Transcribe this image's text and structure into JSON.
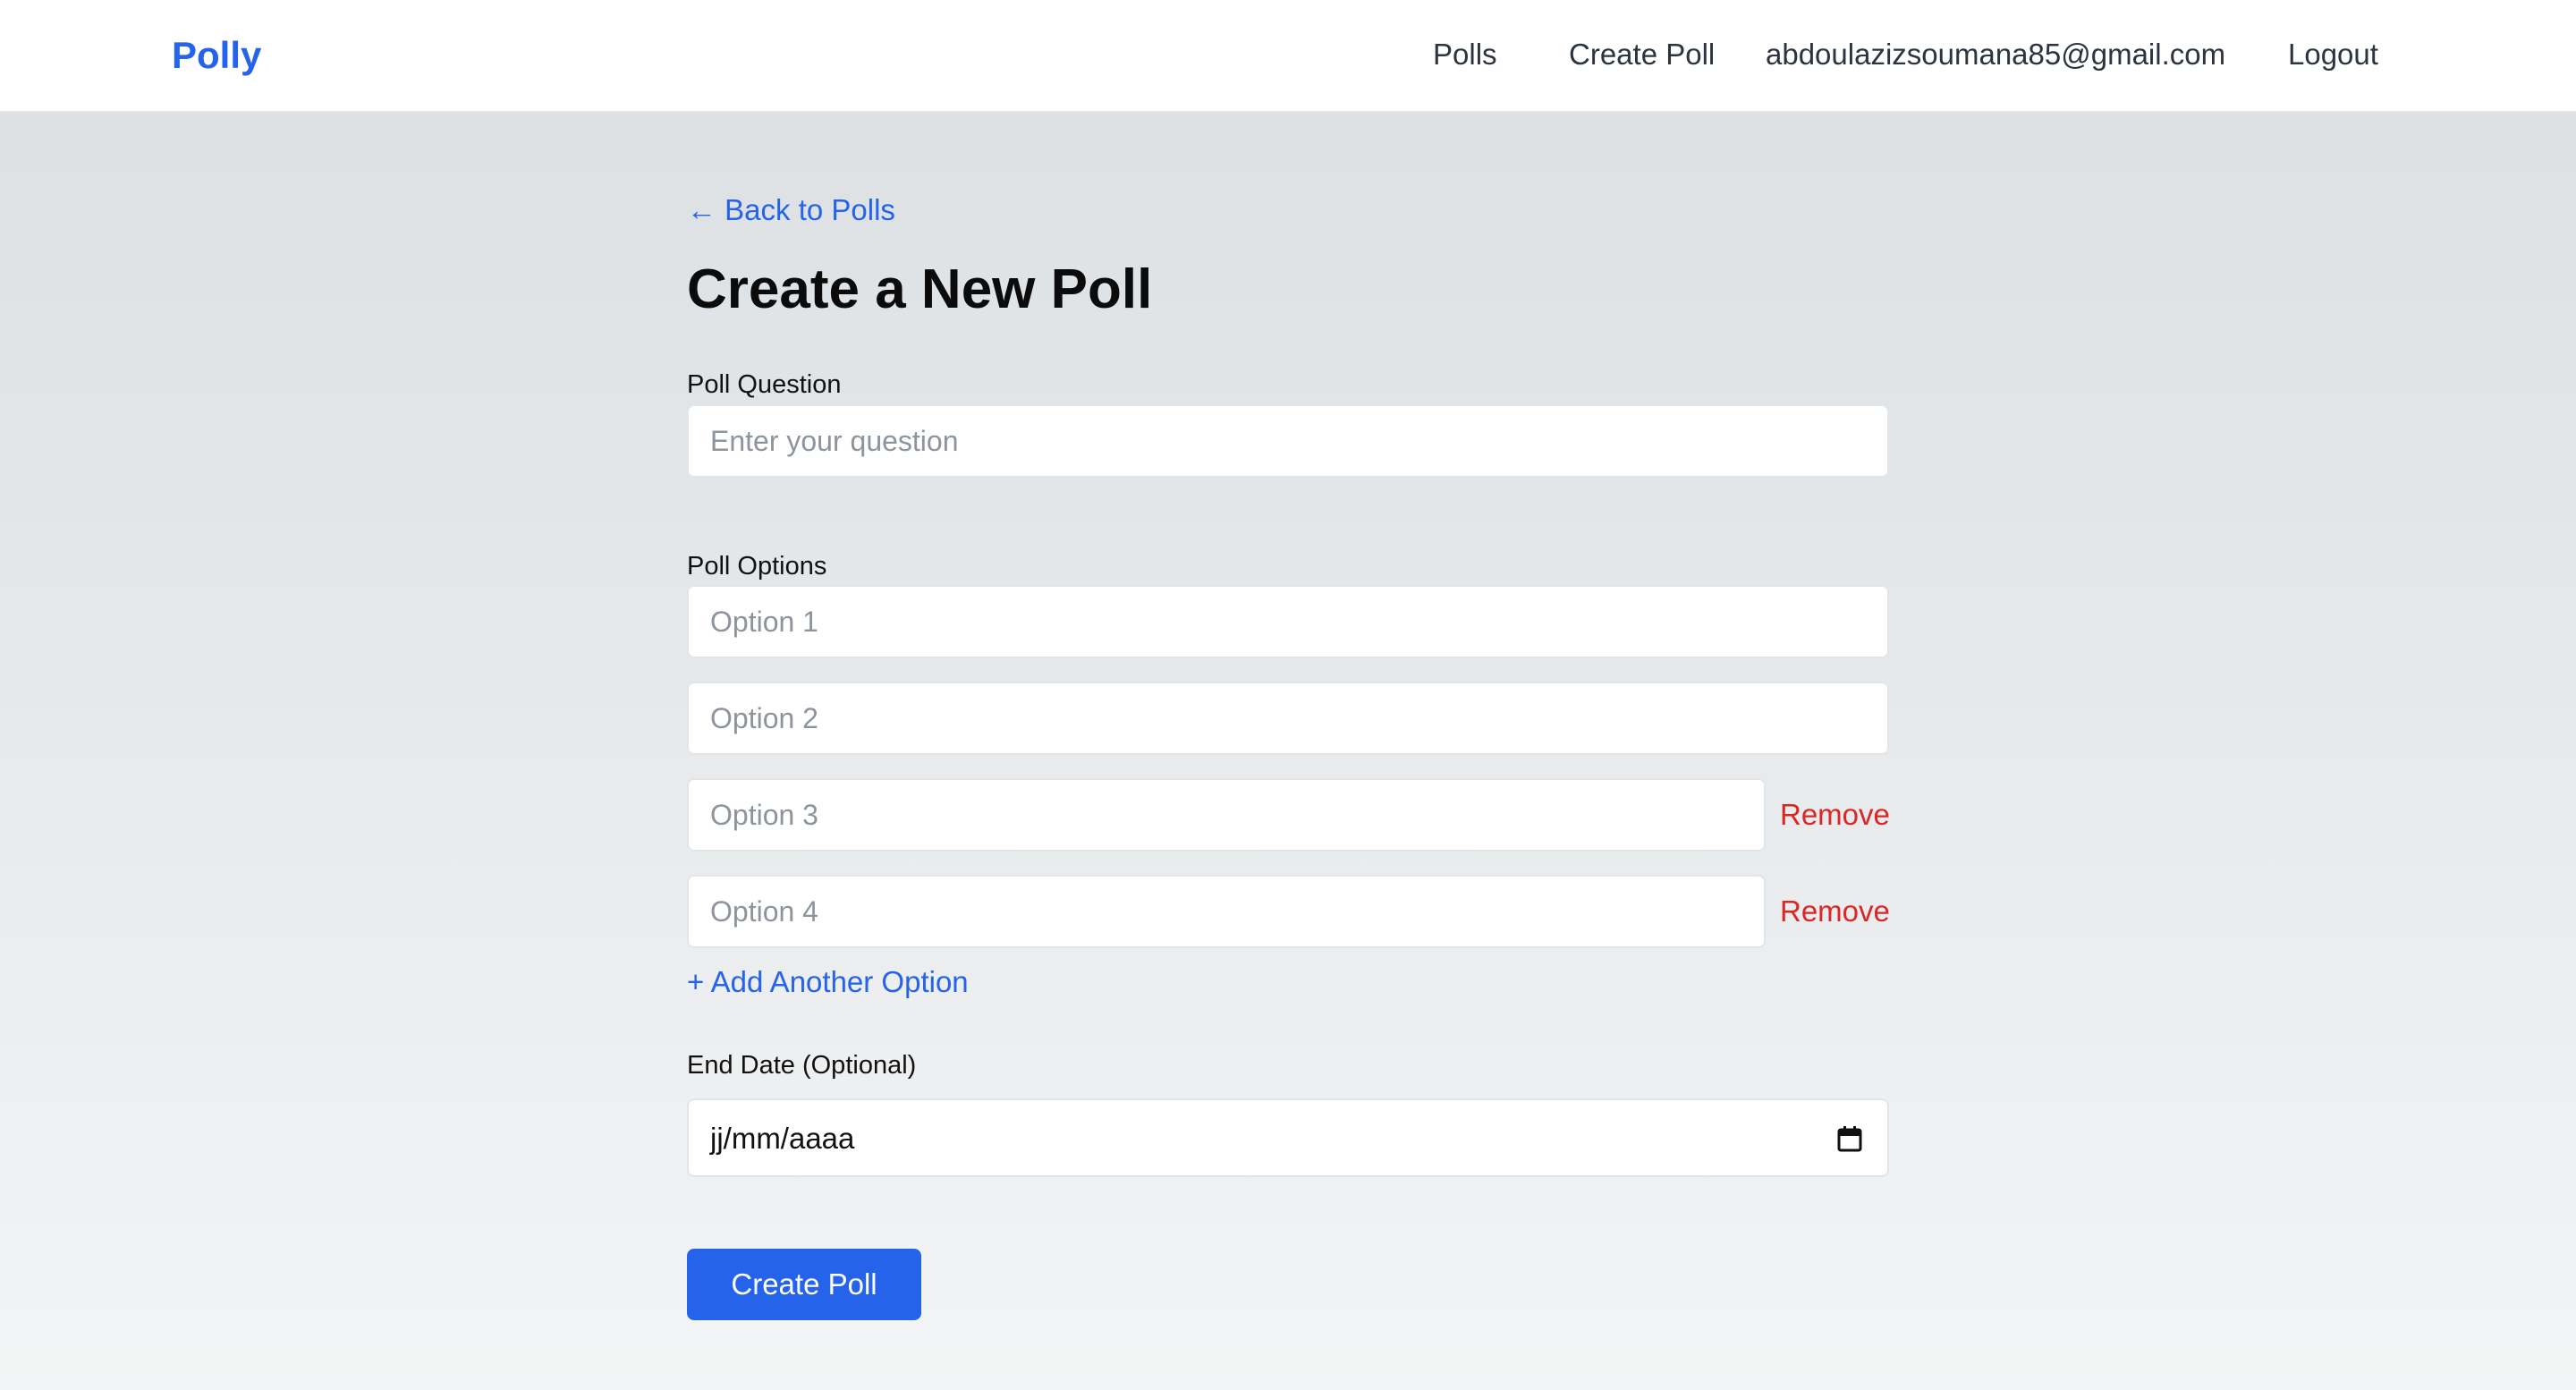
{
  "header": {
    "brand": "Polly",
    "nav": {
      "polls": "Polls",
      "create_poll": "Create Poll",
      "user_email": "abdoulazizsoumana85@gmail.com",
      "logout": "Logout"
    }
  },
  "main": {
    "back_link": "← Back to Polls",
    "title": "Create a New Poll",
    "question": {
      "label": "Poll Question",
      "placeholder": "Enter your question",
      "value": ""
    },
    "options": {
      "label": "Poll Options",
      "items": [
        {
          "placeholder": "Option 1",
          "value": ""
        },
        {
          "placeholder": "Option 2",
          "value": ""
        },
        {
          "placeholder": "Option 3",
          "value": "",
          "remove_label": "Remove"
        },
        {
          "placeholder": "Option 4",
          "value": "",
          "remove_label": "Remove"
        }
      ],
      "add_label": "+ Add Another Option"
    },
    "end_date": {
      "label": "End Date (Optional)",
      "placeholder": "jj/mm/aaaa",
      "icon": "calendar-icon"
    },
    "submit_label": "Create Poll"
  },
  "colors": {
    "accent": "#2563eb",
    "danger": "#dc2626",
    "background": "#e5e8ea"
  }
}
